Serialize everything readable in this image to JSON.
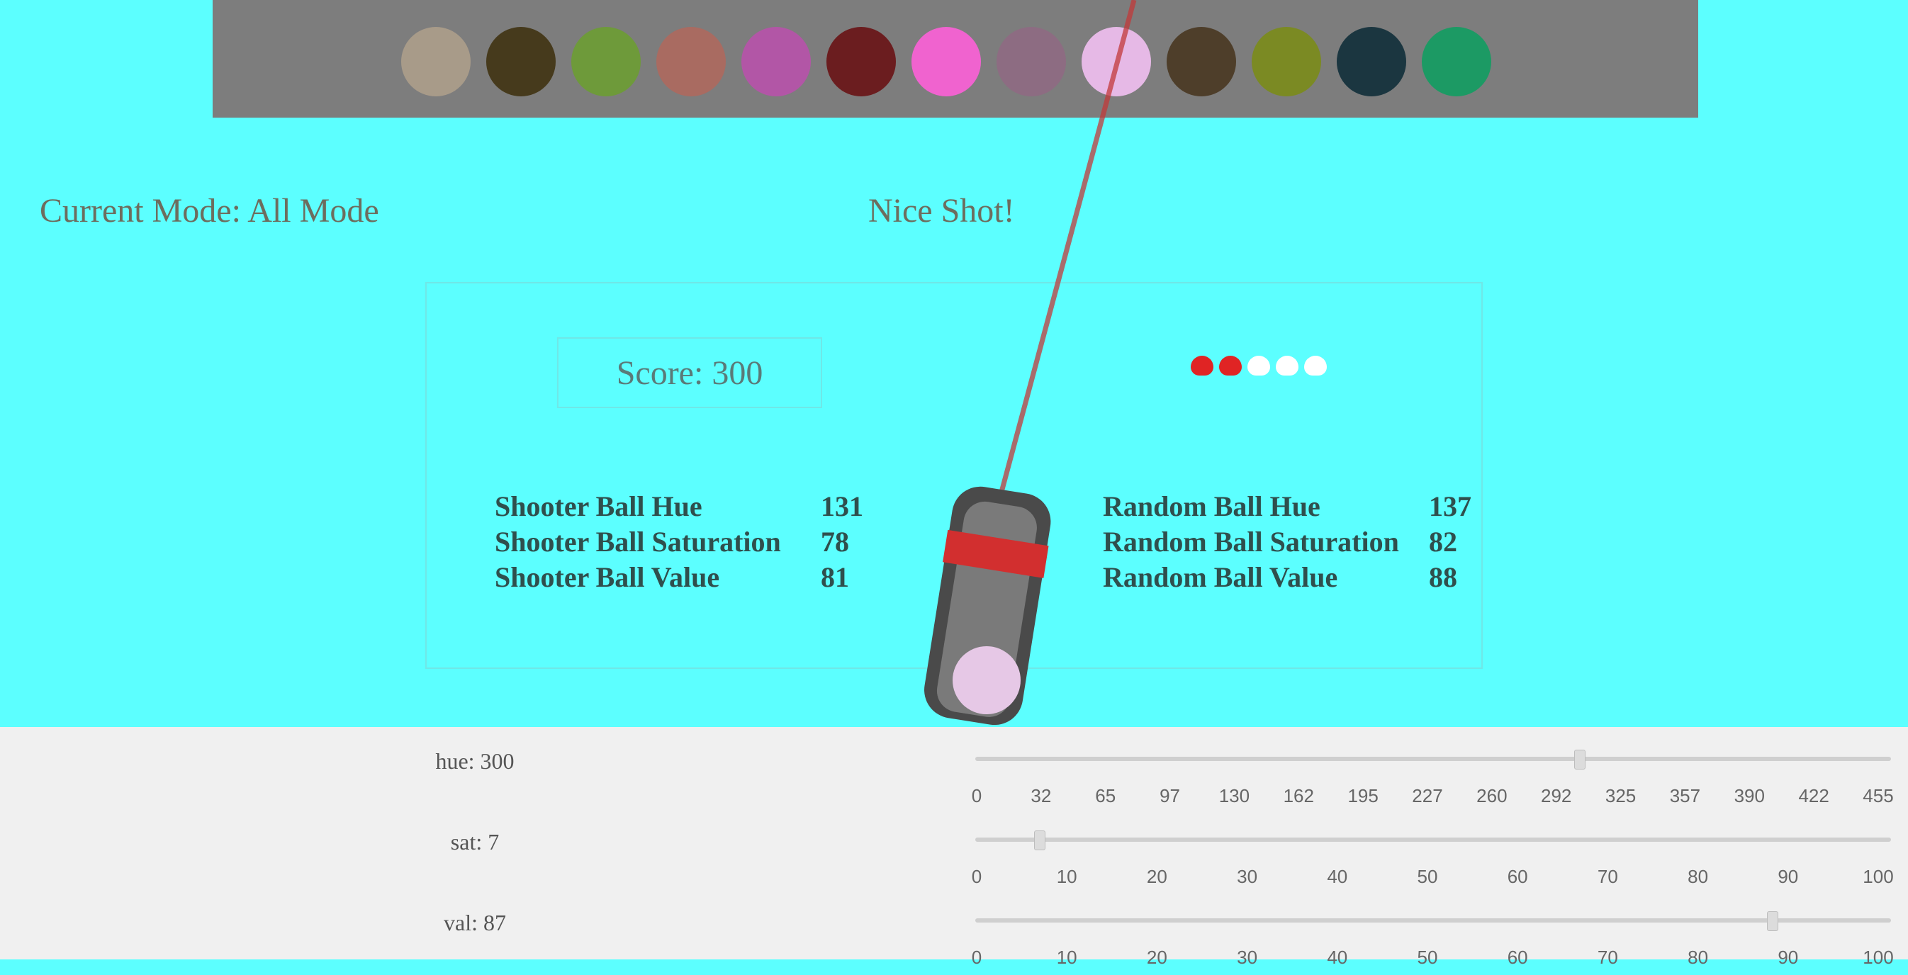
{
  "game": {
    "mode_text": "Current Mode:  All Mode",
    "title": "Nice Shot!",
    "score_text": "Score:  300"
  },
  "ball_colors": [
    "#a89b89",
    "#463a1c",
    "#6e9a3a",
    "#a96b61",
    "#b256a6",
    "#6b1d1f",
    "#f063cf",
    "#8d6c82",
    "#e6b9e6",
    "#4e3e2a",
    "#7b8a23",
    "#1b3640",
    "#1c9a64"
  ],
  "shooter_ball_color": "#e6c8e6",
  "lives": {
    "total": 5,
    "remaining": 2,
    "color_full": "#e02424",
    "color_empty": "#ffffff"
  },
  "shooter_stats": [
    {
      "label": "Shooter Ball Hue",
      "value": "131"
    },
    {
      "label": "Shooter Ball Saturation",
      "value": "78"
    },
    {
      "label": "Shooter Ball Value",
      "value": "81"
    }
  ],
  "random_stats": [
    {
      "label": "Random Ball Hue",
      "value": "137"
    },
    {
      "label": "Random Ball Saturation",
      "value": "82"
    },
    {
      "label": "Random Ball Value",
      "value": "88"
    }
  ],
  "sliders": [
    {
      "label": "hue: 300",
      "value": 300,
      "max": 360,
      "ticks": [
        "0",
        "32",
        "65",
        "97",
        "130",
        "162",
        "195",
        "227",
        "260",
        "292",
        "325",
        "357",
        "390",
        "422",
        "455"
      ]
    },
    {
      "label": "sat: 7",
      "value": 7,
      "max": 100,
      "ticks": [
        "0",
        "10",
        "20",
        "30",
        "40",
        "50",
        "60",
        "70",
        "80",
        "90",
        "100"
      ]
    },
    {
      "label": "val: 87",
      "value": 87,
      "max": 100,
      "ticks": [
        "0",
        "10",
        "20",
        "30",
        "40",
        "50",
        "60",
        "70",
        "80",
        "90",
        "100"
      ]
    }
  ]
}
